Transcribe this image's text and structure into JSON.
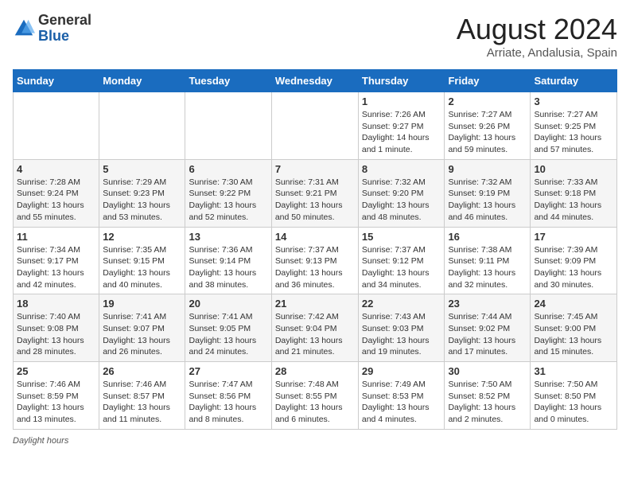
{
  "header": {
    "logo_line1": "General",
    "logo_line2": "Blue",
    "title": "August 2024",
    "subtitle": "Arriate, Andalusia, Spain"
  },
  "days_of_week": [
    "Sunday",
    "Monday",
    "Tuesday",
    "Wednesday",
    "Thursday",
    "Friday",
    "Saturday"
  ],
  "weeks": [
    [
      {
        "day": "",
        "info": ""
      },
      {
        "day": "",
        "info": ""
      },
      {
        "day": "",
        "info": ""
      },
      {
        "day": "",
        "info": ""
      },
      {
        "day": "1",
        "info": "Sunrise: 7:26 AM\nSunset: 9:27 PM\nDaylight: 14 hours and 1 minute."
      },
      {
        "day": "2",
        "info": "Sunrise: 7:27 AM\nSunset: 9:26 PM\nDaylight: 13 hours and 59 minutes."
      },
      {
        "day": "3",
        "info": "Sunrise: 7:27 AM\nSunset: 9:25 PM\nDaylight: 13 hours and 57 minutes."
      }
    ],
    [
      {
        "day": "4",
        "info": "Sunrise: 7:28 AM\nSunset: 9:24 PM\nDaylight: 13 hours and 55 minutes."
      },
      {
        "day": "5",
        "info": "Sunrise: 7:29 AM\nSunset: 9:23 PM\nDaylight: 13 hours and 53 minutes."
      },
      {
        "day": "6",
        "info": "Sunrise: 7:30 AM\nSunset: 9:22 PM\nDaylight: 13 hours and 52 minutes."
      },
      {
        "day": "7",
        "info": "Sunrise: 7:31 AM\nSunset: 9:21 PM\nDaylight: 13 hours and 50 minutes."
      },
      {
        "day": "8",
        "info": "Sunrise: 7:32 AM\nSunset: 9:20 PM\nDaylight: 13 hours and 48 minutes."
      },
      {
        "day": "9",
        "info": "Sunrise: 7:32 AM\nSunset: 9:19 PM\nDaylight: 13 hours and 46 minutes."
      },
      {
        "day": "10",
        "info": "Sunrise: 7:33 AM\nSunset: 9:18 PM\nDaylight: 13 hours and 44 minutes."
      }
    ],
    [
      {
        "day": "11",
        "info": "Sunrise: 7:34 AM\nSunset: 9:17 PM\nDaylight: 13 hours and 42 minutes."
      },
      {
        "day": "12",
        "info": "Sunrise: 7:35 AM\nSunset: 9:15 PM\nDaylight: 13 hours and 40 minutes."
      },
      {
        "day": "13",
        "info": "Sunrise: 7:36 AM\nSunset: 9:14 PM\nDaylight: 13 hours and 38 minutes."
      },
      {
        "day": "14",
        "info": "Sunrise: 7:37 AM\nSunset: 9:13 PM\nDaylight: 13 hours and 36 minutes."
      },
      {
        "day": "15",
        "info": "Sunrise: 7:37 AM\nSunset: 9:12 PM\nDaylight: 13 hours and 34 minutes."
      },
      {
        "day": "16",
        "info": "Sunrise: 7:38 AM\nSunset: 9:11 PM\nDaylight: 13 hours and 32 minutes."
      },
      {
        "day": "17",
        "info": "Sunrise: 7:39 AM\nSunset: 9:09 PM\nDaylight: 13 hours and 30 minutes."
      }
    ],
    [
      {
        "day": "18",
        "info": "Sunrise: 7:40 AM\nSunset: 9:08 PM\nDaylight: 13 hours and 28 minutes."
      },
      {
        "day": "19",
        "info": "Sunrise: 7:41 AM\nSunset: 9:07 PM\nDaylight: 13 hours and 26 minutes."
      },
      {
        "day": "20",
        "info": "Sunrise: 7:41 AM\nSunset: 9:05 PM\nDaylight: 13 hours and 24 minutes."
      },
      {
        "day": "21",
        "info": "Sunrise: 7:42 AM\nSunset: 9:04 PM\nDaylight: 13 hours and 21 minutes."
      },
      {
        "day": "22",
        "info": "Sunrise: 7:43 AM\nSunset: 9:03 PM\nDaylight: 13 hours and 19 minutes."
      },
      {
        "day": "23",
        "info": "Sunrise: 7:44 AM\nSunset: 9:02 PM\nDaylight: 13 hours and 17 minutes."
      },
      {
        "day": "24",
        "info": "Sunrise: 7:45 AM\nSunset: 9:00 PM\nDaylight: 13 hours and 15 minutes."
      }
    ],
    [
      {
        "day": "25",
        "info": "Sunrise: 7:46 AM\nSunset: 8:59 PM\nDaylight: 13 hours and 13 minutes."
      },
      {
        "day": "26",
        "info": "Sunrise: 7:46 AM\nSunset: 8:57 PM\nDaylight: 13 hours and 11 minutes."
      },
      {
        "day": "27",
        "info": "Sunrise: 7:47 AM\nSunset: 8:56 PM\nDaylight: 13 hours and 8 minutes."
      },
      {
        "day": "28",
        "info": "Sunrise: 7:48 AM\nSunset: 8:55 PM\nDaylight: 13 hours and 6 minutes."
      },
      {
        "day": "29",
        "info": "Sunrise: 7:49 AM\nSunset: 8:53 PM\nDaylight: 13 hours and 4 minutes."
      },
      {
        "day": "30",
        "info": "Sunrise: 7:50 AM\nSunset: 8:52 PM\nDaylight: 13 hours and 2 minutes."
      },
      {
        "day": "31",
        "info": "Sunrise: 7:50 AM\nSunset: 8:50 PM\nDaylight: 13 hours and 0 minutes."
      }
    ]
  ],
  "footer": {
    "label": "Daylight hours"
  },
  "colors": {
    "header_bg": "#1a6cbf",
    "header_text": "#ffffff",
    "title_text": "#222222",
    "subtitle_text": "#555555"
  }
}
